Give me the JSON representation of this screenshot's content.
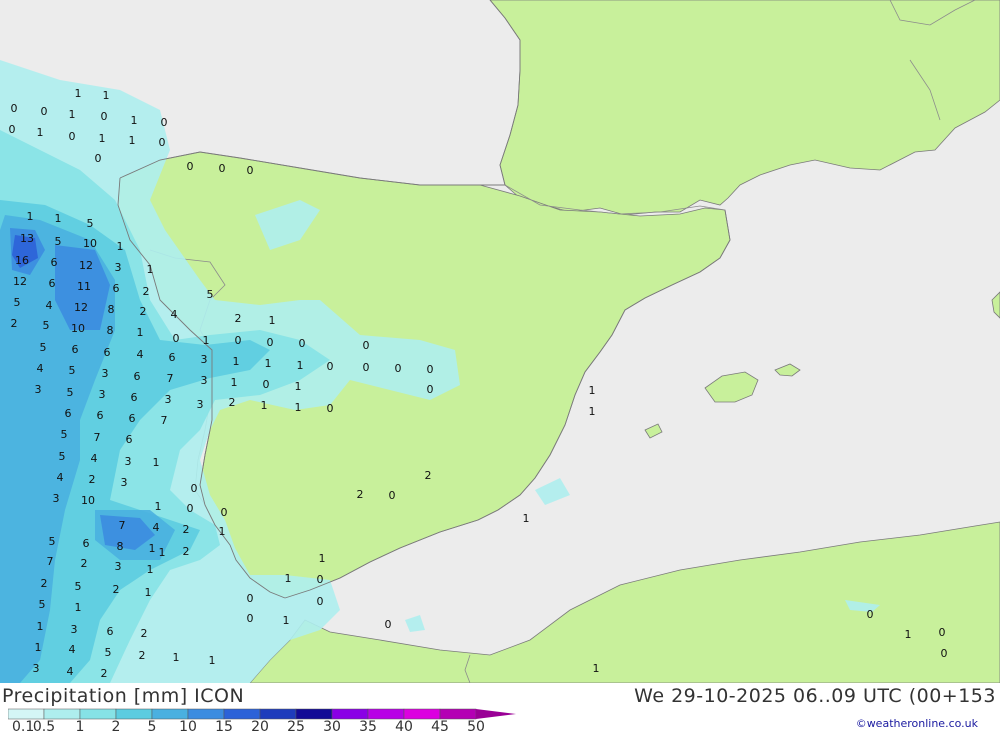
{
  "title": "Precipitation [mm] ICON",
  "valid_time": "We 29-10-2025 06..09 UTC (00+153",
  "credit": "©weatheronline.co.uk",
  "colors": {
    "sea": "#ececec",
    "land": "#c8f09b",
    "border": "#8c8c8c",
    "coast": "#7a7a7a"
  },
  "legend": {
    "labels": [
      "0.1",
      "0.5",
      "1",
      "2",
      "5",
      "10",
      "15",
      "20",
      "25",
      "30",
      "35",
      "40",
      "45",
      "50"
    ],
    "colors": [
      "#d4f6f6",
      "#aeeeee",
      "#86e2e6",
      "#5ccce0",
      "#4ab0e0",
      "#3c8ce0",
      "#2c62d8",
      "#1e3cbc",
      "#120a96",
      "#8a00e6",
      "#b800e6",
      "#dc00e0",
      "#b400b4",
      "#9a0096"
    ]
  },
  "precip_values": [
    "0",
    "0",
    "1",
    "1",
    "0",
    "1",
    "0",
    "1",
    "0",
    "1",
    "0",
    "1",
    "1",
    "0",
    "0",
    "0",
    "0",
    "0",
    "1",
    "1",
    "5",
    "13",
    "5",
    "10",
    "1",
    "16",
    "6",
    "12",
    "3",
    "1",
    "12",
    "6",
    "11",
    "6",
    "2",
    "5",
    "4",
    "12",
    "8",
    "2",
    "2",
    "5",
    "10",
    "8",
    "1",
    "5",
    "6",
    "6",
    "4",
    "6",
    "3",
    "4",
    "5",
    "3",
    "6",
    "7",
    "3",
    "5",
    "3",
    "6",
    "3",
    "6",
    "6",
    "6",
    "7",
    "5",
    "7",
    "6",
    "5",
    "4",
    "3",
    "4",
    "2",
    "3",
    "3",
    "10",
    "7",
    "4",
    "2",
    "1",
    "5",
    "6",
    "8",
    "1",
    "2",
    "7",
    "2",
    "3",
    "1",
    "2",
    "5",
    "2",
    "1",
    "5",
    "1",
    "1",
    "3",
    "6",
    "2",
    "1",
    "4",
    "5",
    "2",
    "1",
    "3",
    "4",
    "2",
    "1",
    "1",
    "1",
    "1",
    "5",
    "4",
    "2",
    "1",
    "0",
    "0",
    "0",
    "0",
    "0",
    "0",
    "0",
    "0",
    "1",
    "1",
    "1",
    "0",
    "1",
    "3",
    "1",
    "0",
    "1",
    "3",
    "2",
    "1",
    "1",
    "0",
    "0",
    "1",
    "1",
    "2",
    "2",
    "0",
    "1",
    "1",
    "1",
    "0",
    "0",
    "0",
    "0",
    "1",
    "0",
    "0",
    "1",
    "0",
    "0",
    "1",
    "0",
    "0",
    "0",
    "1",
    "0",
    "0",
    "0",
    "0",
    "0",
    "0",
    "0",
    "0",
    "0",
    "2",
    "1",
    "1",
    "0"
  ]
}
